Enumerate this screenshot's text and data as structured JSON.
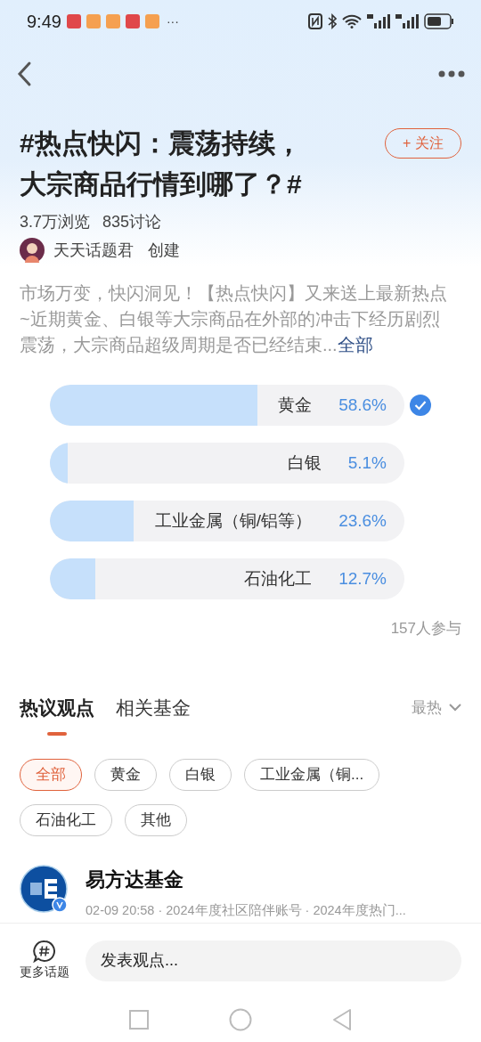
{
  "status_bar": {
    "time": "9:49",
    "more": "···"
  },
  "topic": {
    "title": "#热点快闪：震荡持续，大宗商品行情到哪了？#",
    "follow": "+ 关注",
    "views": "3.7万浏览",
    "discussions": "835讨论",
    "creator": "天天话题君",
    "created": "创建",
    "description": "市场万变，快闪洞见！【热点快闪】又来送上最新热点~近期黄金、白银等大宗商品在外部的冲击下经历剧烈震荡，大宗商品超级周期是否已经结束...",
    "more_link": "全部"
  },
  "poll": {
    "options": [
      {
        "label": "黄金",
        "percent": "58.6%",
        "level": 0.586,
        "selected": true
      },
      {
        "label": "白银",
        "percent": "5.1%",
        "level": 0.051,
        "selected": false
      },
      {
        "label": "工业金属（铜/铝等）",
        "percent": "23.6%",
        "level": 0.236,
        "selected": false
      },
      {
        "label": "石油化工",
        "percent": "12.7%",
        "level": 0.127,
        "selected": false
      }
    ],
    "participants": "157人参与"
  },
  "tabs": [
    {
      "label": "热议观点",
      "selected": true
    },
    {
      "label": "相关基金",
      "selected": false
    }
  ],
  "sort": "最热",
  "filters": [
    {
      "label": "全部",
      "selected": true
    },
    {
      "label": "黄金",
      "selected": false
    },
    {
      "label": "白银",
      "selected": false
    },
    {
      "label": "工业金属（铜...",
      "selected": false
    },
    {
      "label": "石油化工",
      "selected": false
    },
    {
      "label": "其他",
      "selected": false
    }
  ],
  "post": {
    "author": "易方达基金",
    "meta": "02-09 20:58 · 2024年度社区陪伴账号 · 2024年度热门..."
  },
  "bottom_bar": {
    "more_topics": "更多话题",
    "comment_placeholder": "发表观点..."
  }
}
